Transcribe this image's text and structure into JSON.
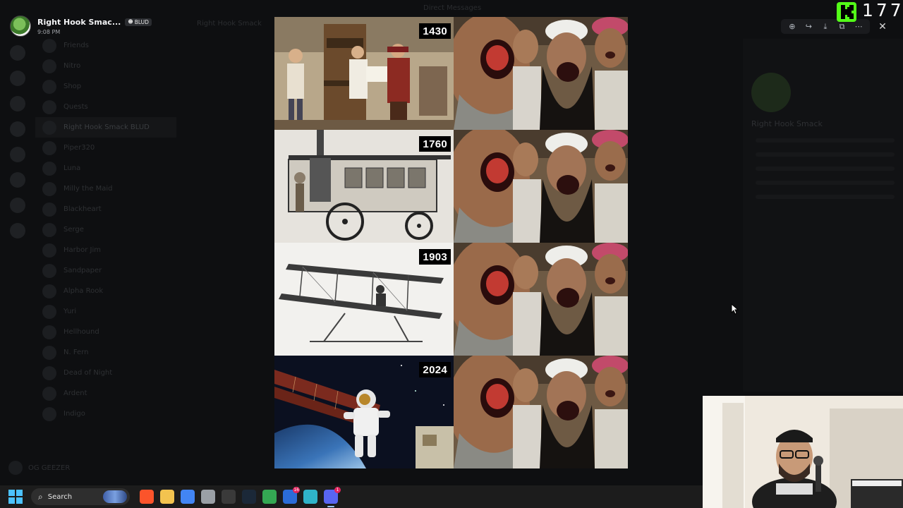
{
  "window": {
    "title": "Direct Messages"
  },
  "viewer": {
    "user_name": "Right Hook Smac...",
    "tag": "BLUD",
    "time": "9:08 PM",
    "toolbar": [
      {
        "name": "zoom-icon",
        "glyph": "⊕"
      },
      {
        "name": "forward-icon",
        "glyph": "↪"
      },
      {
        "name": "download-icon",
        "glyph": "⤓"
      },
      {
        "name": "open-in-browser-icon",
        "glyph": "⧉"
      },
      {
        "name": "more-options-icon",
        "glyph": "⋯"
      }
    ],
    "close_glyph": "✕"
  },
  "stream_overlay": {
    "platform": "Kick",
    "viewer_count": "177",
    "accent": "#53fc18"
  },
  "meme": {
    "panels": [
      {
        "year": "1430",
        "invention": "printing press"
      },
      {
        "year": "1760",
        "invention": "steam car"
      },
      {
        "year": "1903",
        "invention": "airplane"
      },
      {
        "year": "2024",
        "invention": "astronaut and space station"
      }
    ]
  },
  "background": {
    "chat_name": "Right Hook Smack",
    "sidebar_items": [
      "Friends",
      "Nitro",
      "Shop",
      "Quests",
      "Right Hook Smack BLUD",
      "Piper320",
      "Luna",
      "Milly the Maid",
      "Blackheart",
      "Serge",
      "Harbor Jim",
      "Sandpaper",
      "Alpha Rook",
      "Yuri",
      "Hellhound",
      "N. Fern",
      "Dead of Night",
      "Ardent",
      "Indigo"
    ],
    "profile_name": "Right Hook Smack",
    "current_user": "OG GEEZER"
  },
  "taskbar": {
    "search_label": "Search",
    "apps": [
      {
        "name": "brave-icon",
        "color": "#fb542b",
        "badge": ""
      },
      {
        "name": "file-explorer-icon",
        "color": "#f3c34f",
        "badge": ""
      },
      {
        "name": "chrome-icon",
        "color": "#4285f4",
        "badge": ""
      },
      {
        "name": "shield-app-icon",
        "color": "#9aa0a6",
        "badge": ""
      },
      {
        "name": "recording-app-icon",
        "color": "#3a3a3a",
        "badge": ""
      },
      {
        "name": "steam-icon",
        "color": "#1b2838",
        "badge": ""
      },
      {
        "name": "chrome-profile-icon",
        "color": "#34a853",
        "badge": ""
      },
      {
        "name": "browser-app-icon",
        "color": "#2b6cd8",
        "badge": "16"
      },
      {
        "name": "desktop-app-icon",
        "color": "#2fb3c9",
        "badge": ""
      },
      {
        "name": "discord-icon",
        "color": "#5865f2",
        "badge": "1"
      }
    ]
  }
}
